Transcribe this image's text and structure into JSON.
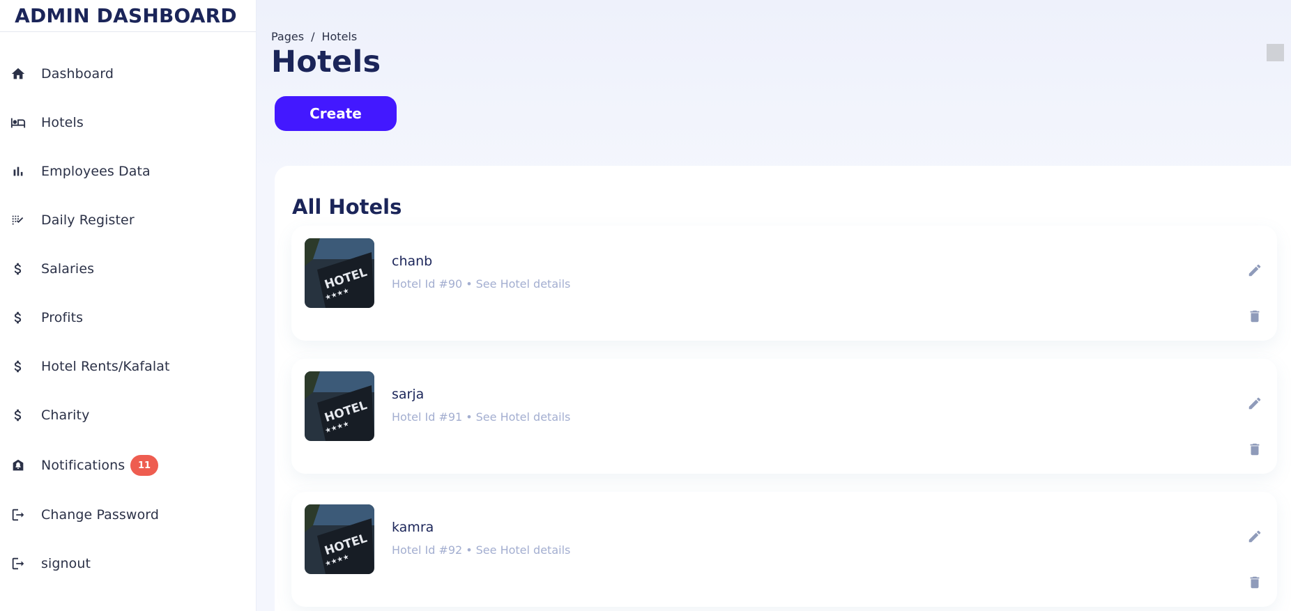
{
  "sidebar": {
    "brand": "ADMIN DASHBOARD",
    "items": [
      {
        "label": "Dashboard",
        "icon": "home-icon"
      },
      {
        "label": "Hotels",
        "icon": "bed-icon"
      },
      {
        "label": "Employees Data",
        "icon": "bar-chart-icon"
      },
      {
        "label": "Daily Register",
        "icon": "checklist-icon"
      },
      {
        "label": "Salaries",
        "icon": "dollar-icon"
      },
      {
        "label": "Profits",
        "icon": "dollar-icon"
      },
      {
        "label": "Hotel Rents/Kafalat",
        "icon": "dollar-icon"
      },
      {
        "label": "Charity",
        "icon": "dollar-icon"
      },
      {
        "label": "Notifications",
        "icon": "bell-icon",
        "badge": "11"
      },
      {
        "label": "Change Password",
        "icon": "logout-icon"
      },
      {
        "label": "signout",
        "icon": "logout-icon"
      }
    ]
  },
  "header": {
    "breadcrumb": [
      "Pages",
      "/",
      "Hotels"
    ],
    "title": "Hotels",
    "create_label": "Create"
  },
  "panel": {
    "title": "All Hotels",
    "hotels": [
      {
        "name": "chanb",
        "id_text": "Hotel Id #90",
        "separator": "•",
        "link": "See Hotel details"
      },
      {
        "name": "sarja",
        "id_text": "Hotel Id #91",
        "separator": "•",
        "link": "See Hotel details"
      },
      {
        "name": "kamra",
        "id_text": "Hotel Id #92",
        "separator": "•",
        "link": "See Hotel details"
      }
    ]
  },
  "colors": {
    "accent": "#4318ff",
    "navy": "#1b2559",
    "muted": "#a3aed0",
    "badge": "#ee5d50"
  }
}
